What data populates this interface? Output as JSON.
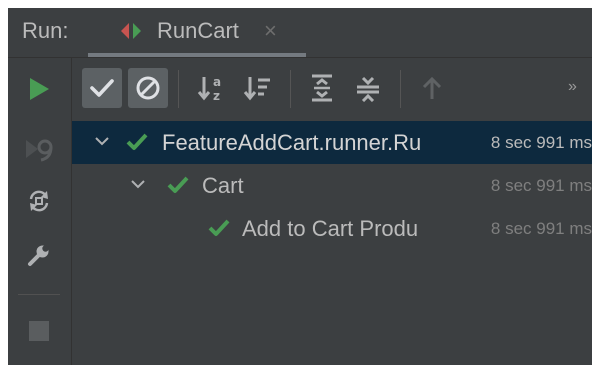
{
  "header": {
    "run_label": "Run:",
    "tab_label": "RunCart",
    "tab_close": "×"
  },
  "toolbar": {
    "more": "»",
    "icons": [
      "run-icon",
      "show-passed-icon",
      "show-ignored-icon",
      "sort-alpha-icon",
      "sort-duration-icon",
      "expand-all-icon",
      "collapse-all-icon",
      "previous-test-icon"
    ]
  },
  "left_toolbar": {
    "icons": [
      "rerun-icon",
      "rerun-failed-icon",
      "toggle-auto-test-icon",
      "settings-wrench-icon",
      "stop-icon"
    ]
  },
  "tree": {
    "rows": [
      {
        "name": "FeatureAddCart.runner.Ru",
        "duration": "8 sec 991 ms",
        "status": "passed",
        "selected": true
      },
      {
        "name": "Cart",
        "duration": "8 sec 991 ms",
        "status": "passed",
        "selected": false
      },
      {
        "name": "Add to Cart Produ",
        "duration": "8 sec 991 ms",
        "status": "passed",
        "selected": false
      }
    ]
  },
  "colors": {
    "background": "#3c3f41",
    "selection": "#0d293e",
    "pass_green": "#499c54",
    "text": "#bbbbbb"
  }
}
